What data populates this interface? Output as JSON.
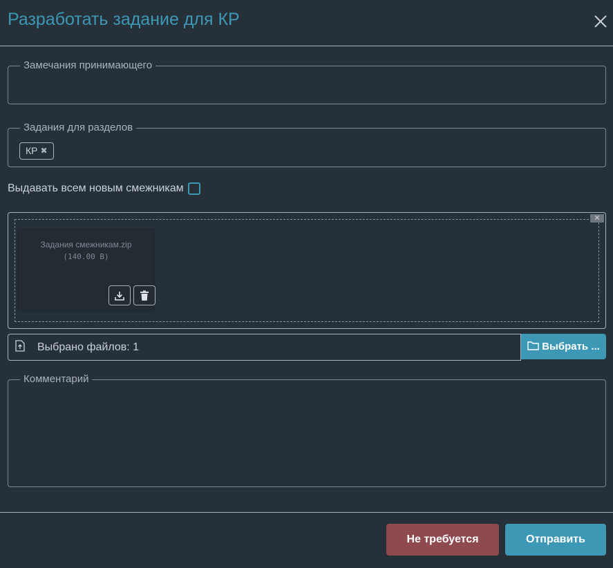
{
  "dialog": {
    "title": "Разработать задание для КР"
  },
  "fields": {
    "remarks_label": "Замечания принимающего",
    "sections_label": "Задания для разделов",
    "section_tags": [
      "КР"
    ],
    "issue_to_new_label": "Выдавать всем новым смежникам",
    "issue_to_new_checked": false,
    "comment_label": "Комментарий"
  },
  "upload": {
    "file_name": "Задания смежникам.zip",
    "file_size": "(140.00 B)",
    "selected_files_text": "Выбрано файлов: 1",
    "browse_label": "Выбрать ..."
  },
  "actions": {
    "decline_label": "Не требуется",
    "send_label": "Отправить"
  },
  "colors": {
    "accent": "#3c98b5",
    "danger": "#8e4a4f",
    "background": "#263039"
  },
  "icons": {
    "close": "close-icon",
    "tag_remove": "x-icon",
    "download": "download-icon",
    "delete": "trash-icon",
    "file_upload": "file-upload-icon",
    "folder": "folder-icon"
  }
}
